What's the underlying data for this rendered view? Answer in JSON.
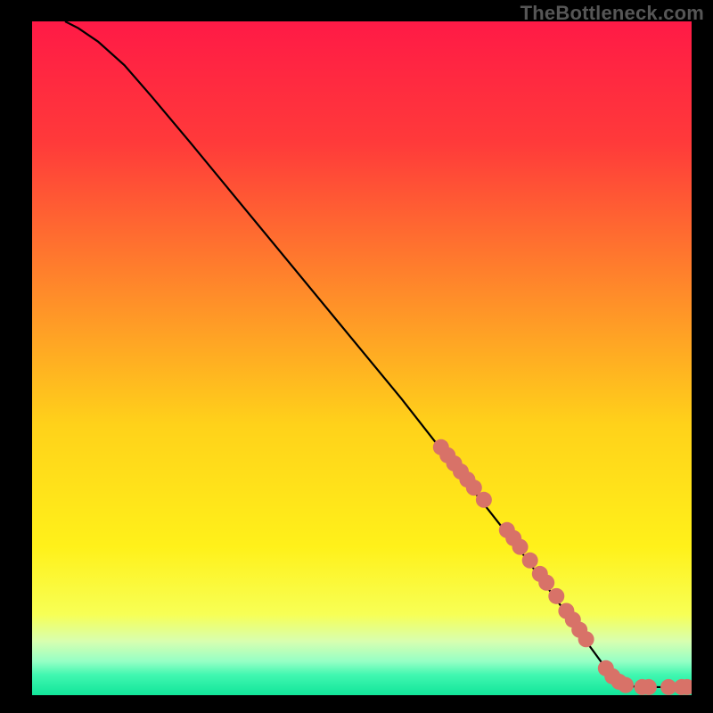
{
  "watermark": "TheBottleneck.com",
  "chart_data": {
    "type": "line",
    "title": "",
    "xlabel": "",
    "ylabel": "",
    "xlim": [
      0,
      100
    ],
    "ylim": [
      0,
      100
    ],
    "grid": false,
    "gradient_stops": [
      {
        "offset": 0,
        "color": "#ff1a46"
      },
      {
        "offset": 18,
        "color": "#ff3a3a"
      },
      {
        "offset": 40,
        "color": "#ff8a2a"
      },
      {
        "offset": 60,
        "color": "#ffd21a"
      },
      {
        "offset": 78,
        "color": "#fff11a"
      },
      {
        "offset": 88,
        "color": "#f7ff55"
      },
      {
        "offset": 92,
        "color": "#d8ffb0"
      },
      {
        "offset": 95,
        "color": "#95ffc5"
      },
      {
        "offset": 97,
        "color": "#40f7b0"
      },
      {
        "offset": 100,
        "color": "#12e59a"
      }
    ],
    "curve": [
      {
        "x": 5,
        "y": 100
      },
      {
        "x": 7,
        "y": 99
      },
      {
        "x": 10,
        "y": 97
      },
      {
        "x": 14,
        "y": 93.5
      },
      {
        "x": 18,
        "y": 89
      },
      {
        "x": 24,
        "y": 82
      },
      {
        "x": 32,
        "y": 72.5
      },
      {
        "x": 40,
        "y": 63
      },
      {
        "x": 48,
        "y": 53.5
      },
      {
        "x": 56,
        "y": 44
      },
      {
        "x": 62,
        "y": 36.5
      },
      {
        "x": 68,
        "y": 29
      },
      {
        "x": 74,
        "y": 21.5
      },
      {
        "x": 80,
        "y": 13.5
      },
      {
        "x": 84,
        "y": 8
      },
      {
        "x": 87,
        "y": 4
      },
      {
        "x": 89,
        "y": 2
      },
      {
        "x": 91,
        "y": 1.3
      },
      {
        "x": 94,
        "y": 1.2
      },
      {
        "x": 97,
        "y": 1.2
      },
      {
        "x": 99,
        "y": 1.2
      }
    ],
    "markers": [
      {
        "x": 62,
        "y": 36.8
      },
      {
        "x": 63,
        "y": 35.6
      },
      {
        "x": 64,
        "y": 34.4
      },
      {
        "x": 65,
        "y": 33.2
      },
      {
        "x": 66,
        "y": 32.0
      },
      {
        "x": 67,
        "y": 30.8
      },
      {
        "x": 68.5,
        "y": 29.0
      },
      {
        "x": 72,
        "y": 24.5
      },
      {
        "x": 73,
        "y": 23.3
      },
      {
        "x": 74,
        "y": 22.0
      },
      {
        "x": 75.5,
        "y": 20.0
      },
      {
        "x": 77,
        "y": 18.0
      },
      {
        "x": 78,
        "y": 16.7
      },
      {
        "x": 79.5,
        "y": 14.7
      },
      {
        "x": 81,
        "y": 12.5
      },
      {
        "x": 82,
        "y": 11.2
      },
      {
        "x": 83,
        "y": 9.7
      },
      {
        "x": 84,
        "y": 8.3
      },
      {
        "x": 87,
        "y": 4.0
      },
      {
        "x": 88,
        "y": 2.8
      },
      {
        "x": 89,
        "y": 2.0
      },
      {
        "x": 90,
        "y": 1.5
      },
      {
        "x": 92.5,
        "y": 1.2
      },
      {
        "x": 93.5,
        "y": 1.2
      },
      {
        "x": 96.5,
        "y": 1.2
      },
      {
        "x": 98.5,
        "y": 1.2
      },
      {
        "x": 99.3,
        "y": 1.2
      }
    ],
    "marker_color": "#d87268",
    "marker_radius": 9
  }
}
